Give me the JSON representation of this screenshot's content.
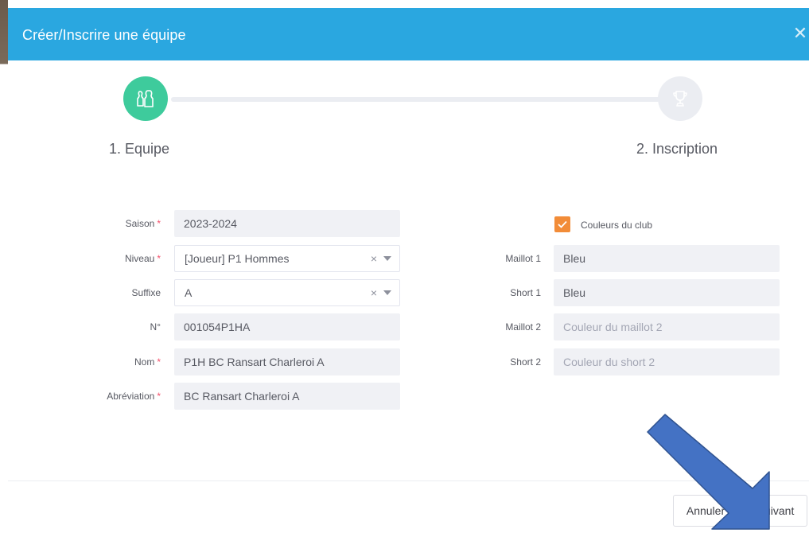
{
  "modal": {
    "title": "Créer/Inscrire une équipe",
    "close_icon": "close-icon",
    "header_color": "#2aa7e0"
  },
  "stepper": {
    "steps": [
      {
        "label": "1. Equipe",
        "icon": "team-icon",
        "active": true,
        "color": "#3ecb9c"
      },
      {
        "label": "2. Inscription",
        "icon": "trophy-icon",
        "active": false,
        "color": "#ebedf2"
      }
    ]
  },
  "form_left": {
    "saison": {
      "label": "Saison",
      "required": "*",
      "value": "2023-2024"
    },
    "niveau": {
      "label": "Niveau",
      "required": "*",
      "value": "[Joueur] P1 Hommes",
      "clear": "×"
    },
    "suffixe": {
      "label": "Suffixe",
      "value": "A",
      "clear": "×"
    },
    "numero": {
      "label": "N°",
      "value": "001054P1HA"
    },
    "nom": {
      "label": "Nom",
      "required": "*",
      "value": "P1H BC Ransart Charleroi A"
    },
    "abreviation": {
      "label": "Abréviation",
      "required": "*",
      "value": "BC Ransart Charleroi A"
    }
  },
  "form_right": {
    "couleurs_club": {
      "label": "Couleurs du club",
      "checked": true,
      "color": "#f28c38"
    },
    "maillot1": {
      "label": "Maillot 1",
      "value": "Bleu"
    },
    "short1": {
      "label": "Short 1",
      "value": "Bleu"
    },
    "maillot2": {
      "label": "Maillot 2",
      "placeholder": "Couleur du maillot 2"
    },
    "short2": {
      "label": "Short 2",
      "placeholder": "Couleur du short 2"
    }
  },
  "footer": {
    "cancel_label": "Annuler",
    "next_label": "Suivant"
  },
  "annotation": {
    "arrow_color": "#4472c4",
    "arrow_target": "next-button"
  }
}
